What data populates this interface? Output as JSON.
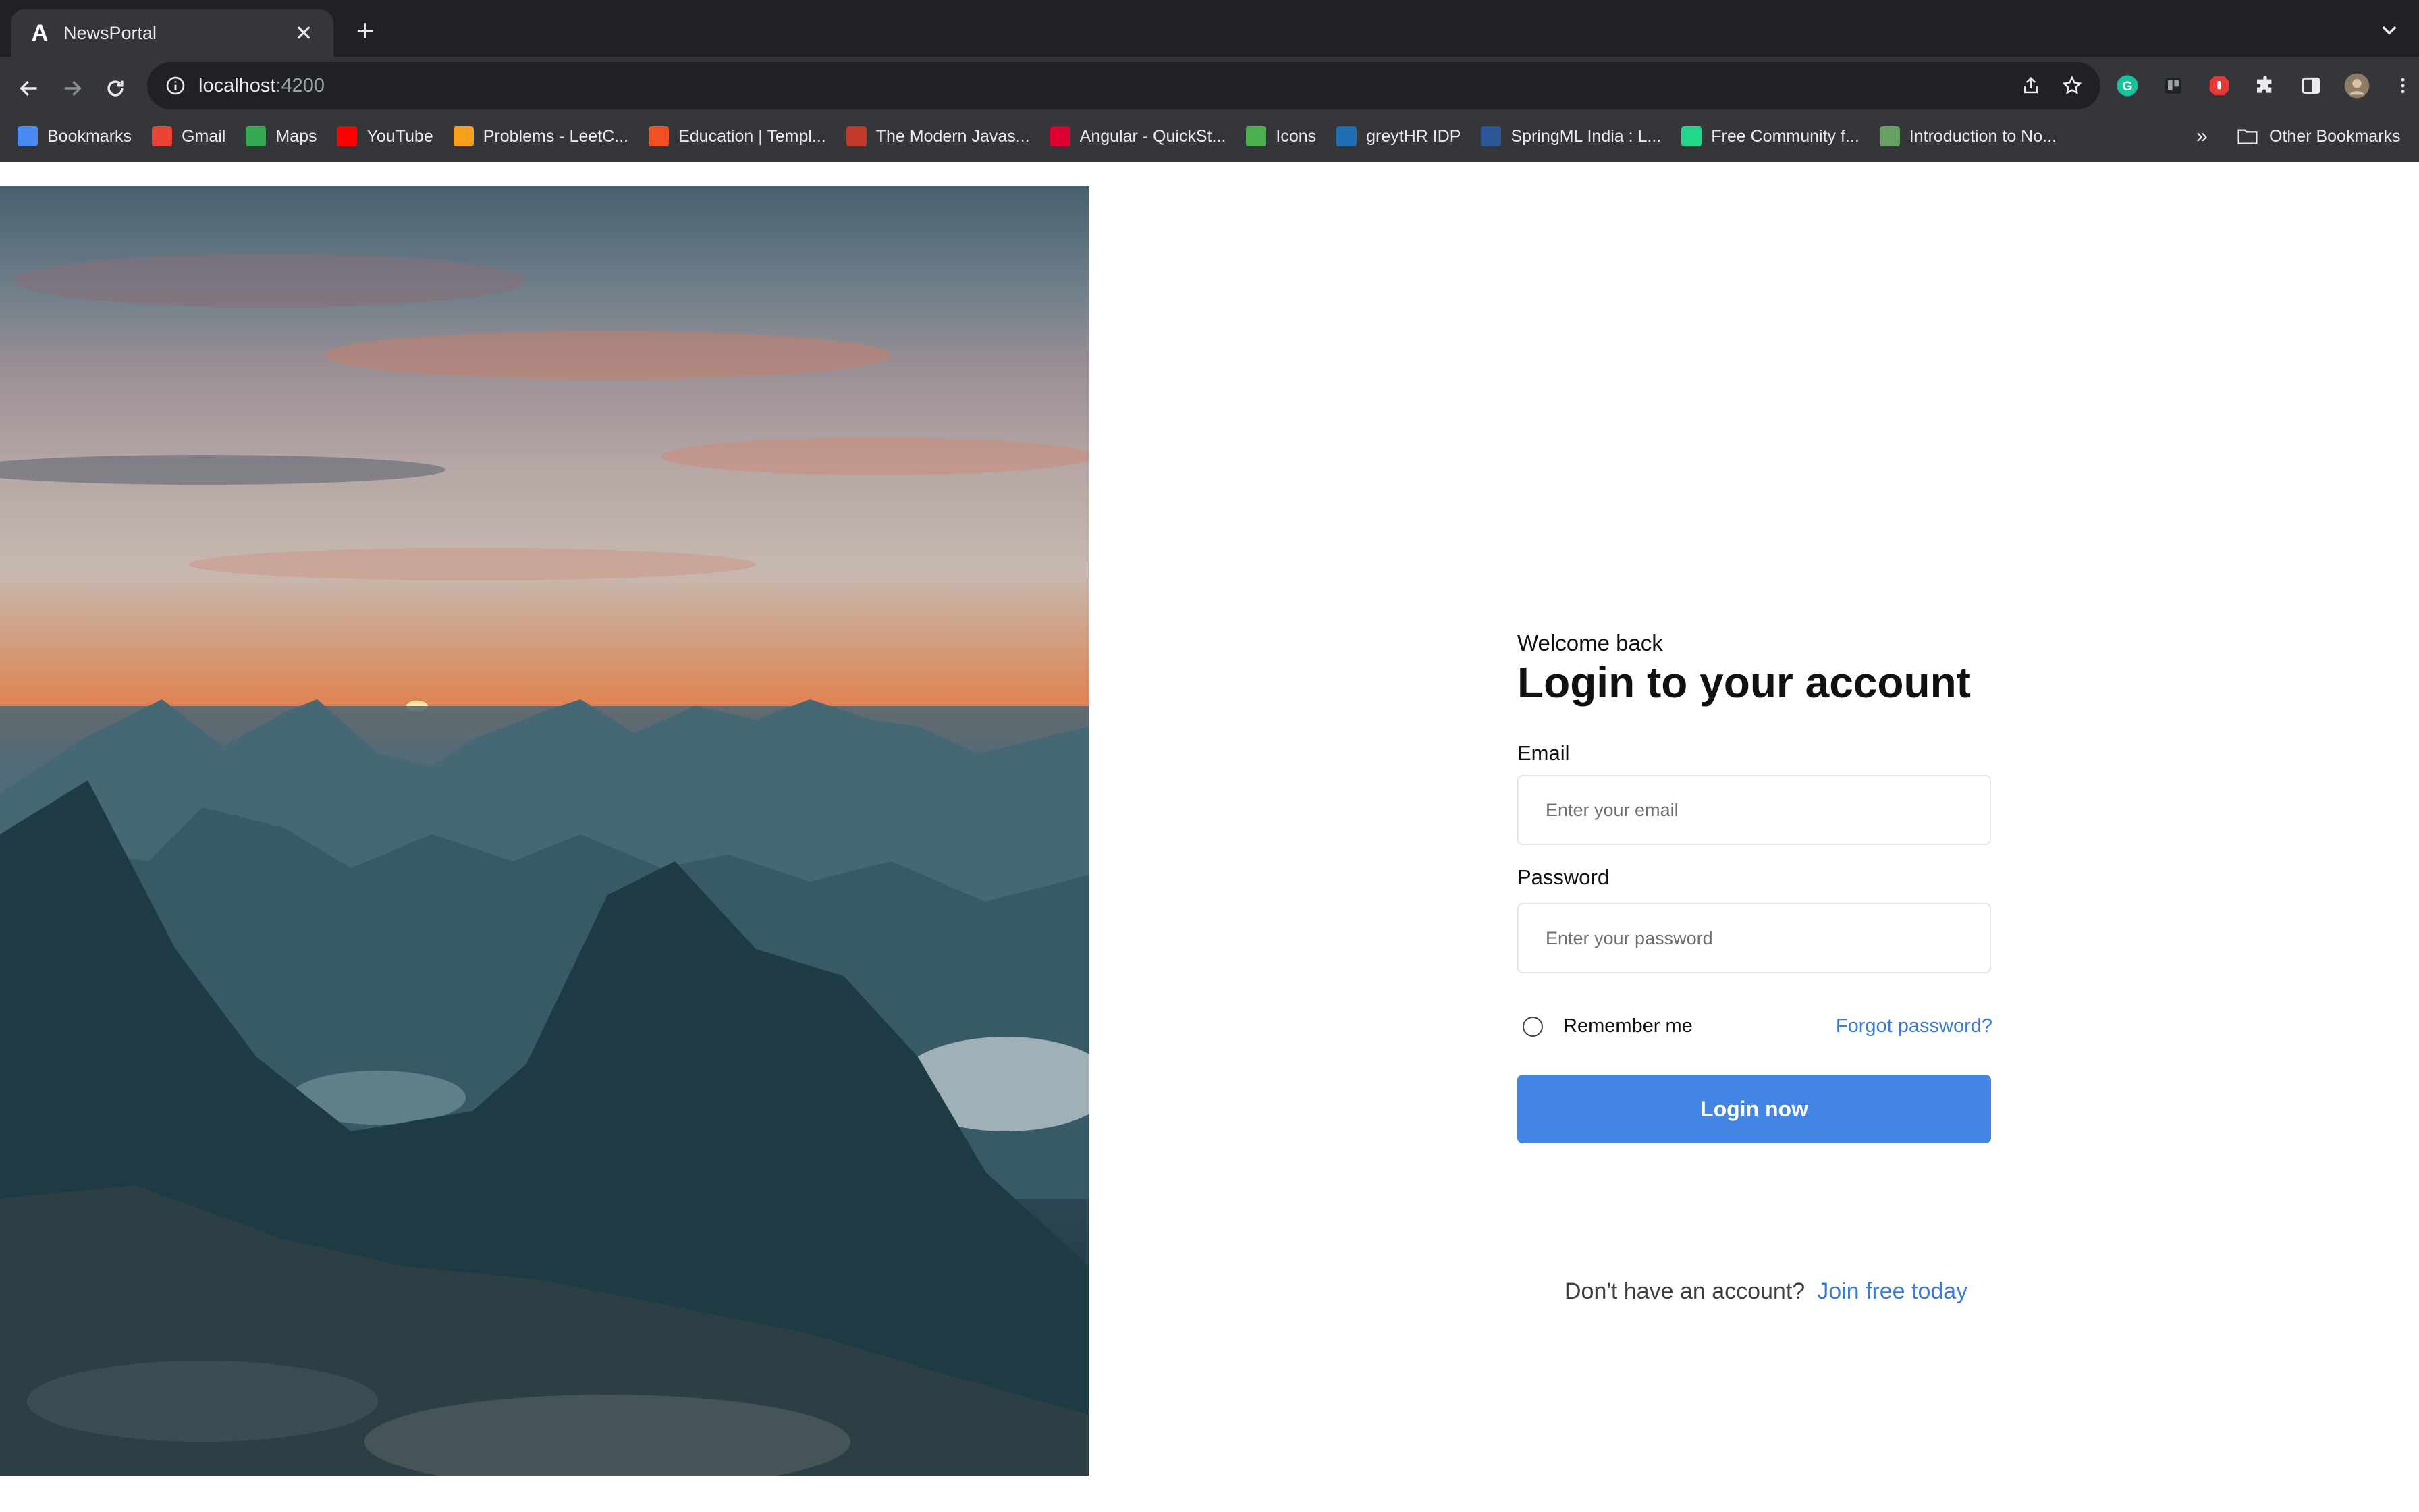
{
  "browser": {
    "tab": {
      "title": "NewsPortal",
      "favicon": "A",
      "close": "✕"
    },
    "new_tab": "+",
    "url": {
      "host": "localhost",
      "port": ":4200"
    },
    "bookmarks": [
      {
        "label": "Bookmarks",
        "icon": "star-icon",
        "color": "#4a8af4"
      },
      {
        "label": "Gmail",
        "icon": "gmail-icon",
        "color": "#ea4335"
      },
      {
        "label": "Maps",
        "icon": "maps-icon",
        "color": "#34a853"
      },
      {
        "label": "YouTube",
        "icon": "youtube-icon",
        "color": "#ff0000"
      },
      {
        "label": "Problems - LeetC...",
        "icon": "leetcode-icon",
        "color": "#f89f1b"
      },
      {
        "label": "Education | Templ...",
        "icon": "microsoft-icon",
        "color": "#f25022"
      },
      {
        "label": "The Modern Javas...",
        "icon": "javascript-icon",
        "color": "#c0392b"
      },
      {
        "label": "Angular - QuickSt...",
        "icon": "angular-icon",
        "color": "#dd0031"
      },
      {
        "label": "Icons",
        "icon": "shield-icon",
        "color": "#4caf50"
      },
      {
        "label": "greytHR IDP",
        "icon": "greythr-icon",
        "color": "#1f6fb2"
      },
      {
        "label": "SpringML India : L...",
        "icon": "springml-icon",
        "color": "#2b5797"
      },
      {
        "label": "Free Community f...",
        "icon": "pycharm-icon",
        "color": "#21d789"
      },
      {
        "label": "Introduction to No...",
        "icon": "nodejs-icon",
        "color": "#68a063"
      }
    ],
    "more_bookmarks": "»",
    "other_bookmarks": "Other Bookmarks"
  },
  "login": {
    "welcome": "Welcome back",
    "title": "Login to your account",
    "email_label": "Email",
    "email_placeholder": "Enter your email",
    "password_label": "Password",
    "password_placeholder": "Enter your password",
    "remember_label": "Remember me",
    "forgot_link": "Forgot password?",
    "submit_label": "Login now",
    "signup_text": "Don't have an account?",
    "signup_link": "Join free today"
  },
  "colors": {
    "accent": "#4285e5",
    "link": "#3a7bd5",
    "chrome_dark": "#202124",
    "chrome_toolbar": "#35363a"
  }
}
